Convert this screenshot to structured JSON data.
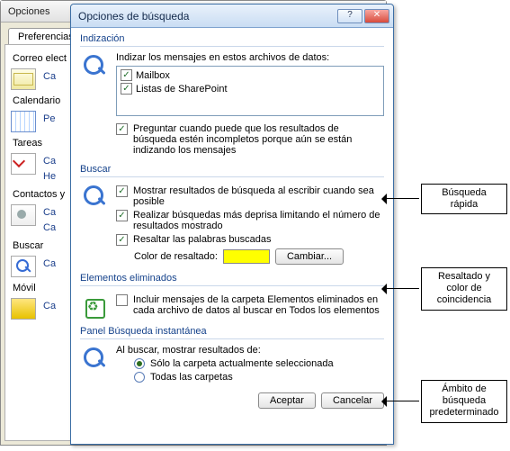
{
  "back_window": {
    "title": "Opciones",
    "tab": "Preferencias",
    "sidebar": {
      "mail_title": "Correo elect",
      "mail_link": "Ca",
      "cal_title": "Calendario",
      "cal_link": "Pe",
      "tasks_title": "Tareas",
      "tasks_link1": "Ca",
      "tasks_link2": "He",
      "contacts_title": "Contactos y",
      "contacts_link1": "Ca",
      "contacts_link2": "Ca",
      "search_title": "Buscar",
      "search_link": "Ca",
      "mobile_title": "Móvil",
      "mobile_link": "Ca"
    }
  },
  "dialog": {
    "title": "Opciones de búsqueda",
    "indexing": {
      "title": "Indización",
      "label": "Indizar los mensajes en estos archivos de datos:",
      "items": [
        {
          "label": "Mailbox",
          "checked": true
        },
        {
          "label": "Listas de SharePoint",
          "checked": true
        }
      ],
      "prompt": {
        "checked": true,
        "text": "Preguntar cuando puede que los resultados de búsqueda estén incompletos porque aún se están indizando los mensajes"
      }
    },
    "search": {
      "title": "Buscar",
      "opt_show": {
        "checked": true,
        "text": "Mostrar resultados de búsqueda al escribir cuando sea posible"
      },
      "opt_fast": {
        "checked": true,
        "text": "Realizar búsquedas más deprisa limitando el número de resultados mostrado"
      },
      "opt_highlight": {
        "checked": true,
        "text": "Resaltar las palabras buscadas"
      },
      "color_label": "Color de resaltado:",
      "color_value": "#ffff00",
      "change_btn": "Cambiar..."
    },
    "deleted": {
      "title": "Elementos eliminados",
      "opt": {
        "checked": false,
        "text": "Incluir mensajes de la carpeta Elementos eliminados en cada archivo de datos al buscar en Todos los elementos"
      }
    },
    "panel": {
      "title": "Panel Búsqueda instantánea",
      "label": "Al buscar, mostrar resultados de:",
      "radio_current": "Sólo la carpeta actualmente seleccionada",
      "radio_all": "Todas las carpetas",
      "selected": "current"
    },
    "buttons": {
      "ok": "Aceptar",
      "cancel": "Cancelar"
    }
  },
  "callouts": {
    "quick": "Búsqueda rápida",
    "highlight": "Resaltado y color de coincidencia",
    "scope": "Ámbito de búsqueda predeterminado"
  }
}
